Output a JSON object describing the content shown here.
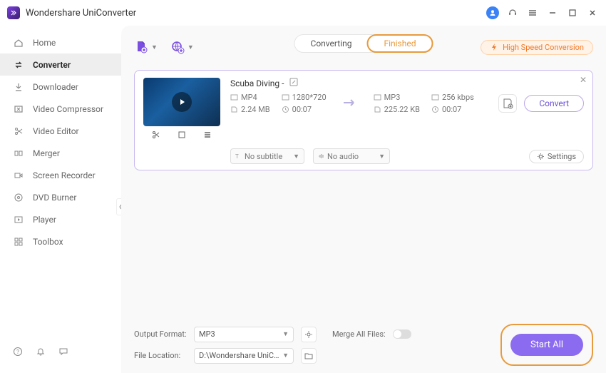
{
  "app": {
    "title": "Wondershare UniConverter"
  },
  "sidebar": {
    "items": [
      {
        "label": "Home"
      },
      {
        "label": "Converter"
      },
      {
        "label": "Downloader"
      },
      {
        "label": "Video Compressor"
      },
      {
        "label": "Video Editor"
      },
      {
        "label": "Merger"
      },
      {
        "label": "Screen Recorder"
      },
      {
        "label": "DVD Burner"
      },
      {
        "label": "Player"
      },
      {
        "label": "Toolbox"
      }
    ]
  },
  "tabs": {
    "converting": "Converting",
    "finished": "Finished"
  },
  "highspeed": "High Speed Conversion",
  "file": {
    "title": "Scuba Diving -",
    "src": {
      "format": "MP4",
      "resolution": "1280*720",
      "size": "2.24 MB",
      "duration": "00:07"
    },
    "dst": {
      "format": "MP3",
      "bitrate": "256 kbps",
      "size": "225.22 KB",
      "duration": "00:07"
    },
    "subtitle": "No subtitle",
    "audio": "No audio",
    "settings": "Settings",
    "convert": "Convert"
  },
  "bottom": {
    "outputFormatLabel": "Output Format:",
    "outputFormatValue": "MP3",
    "fileLocationLabel": "File Location:",
    "fileLocationValue": "D:\\Wondershare UniConverter",
    "mergeLabel": "Merge All Files:",
    "startAll": "Start All"
  }
}
